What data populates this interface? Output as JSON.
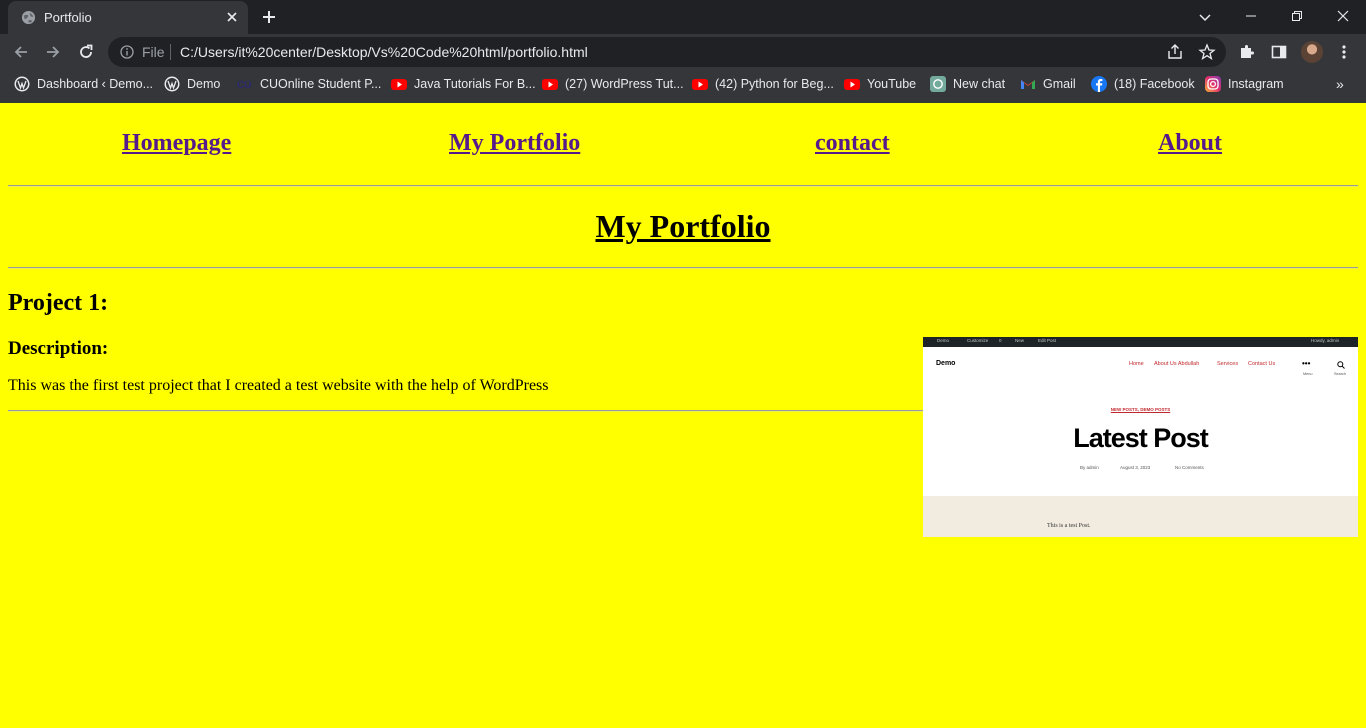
{
  "browser": {
    "tab_title": "Portfolio",
    "address_prefix": "File",
    "url": "C:/Users/it%20center/Desktop/Vs%20Code%20html/portfolio.html",
    "bookmarks": [
      {
        "label": "Dashboard ‹ Demo...",
        "icon": "wordpress-icon"
      },
      {
        "label": "Demo",
        "icon": "wordpress-icon"
      },
      {
        "label": "CUOnline Student P...",
        "icon": "cu-icon"
      },
      {
        "label": "Java Tutorials For B...",
        "icon": "youtube-icon"
      },
      {
        "label": "(27) WordPress Tut...",
        "icon": "youtube-icon"
      },
      {
        "label": "(42) Python for Beg...",
        "icon": "youtube-icon"
      },
      {
        "label": "YouTube",
        "icon": "youtube-icon"
      },
      {
        "label": "New chat",
        "icon": "chatgpt-icon"
      },
      {
        "label": "Gmail",
        "icon": "gmail-icon"
      },
      {
        "label": "(18) Facebook",
        "icon": "facebook-icon"
      },
      {
        "label": "Instagram",
        "icon": "instagram-icon"
      }
    ],
    "bookmarks_more": "»"
  },
  "nav": {
    "links": [
      "Homepage",
      "My Portfolio",
      "contact",
      "About"
    ]
  },
  "page": {
    "title": "My Portfolio",
    "project_title": "Project 1:",
    "description_heading": "Description:",
    "description_text": "This was the first test project that I created a test website with the help of WordPress"
  },
  "thumbnail": {
    "admin_bar": [
      "Demo",
      "Customize",
      "0",
      "New",
      "Edit Post"
    ],
    "admin_user": "Howdy, admin",
    "site_name": "Demo",
    "menu": [
      "Home",
      "About Us Abdullah",
      "Services",
      "Contact Us"
    ],
    "menu_label": "Menu",
    "search_label": "Search",
    "categories": "NEW POSTS, DEMO POSTS",
    "post_title": "Latest Post",
    "meta": [
      "By admin",
      "August 3, 2023",
      "No Comments"
    ],
    "post_body": "This is a test Post."
  },
  "colors": {
    "page_background": "#ffff00",
    "link": "#551a8b",
    "chrome_dark": "#202124",
    "chrome_toolbar": "#35363a"
  }
}
